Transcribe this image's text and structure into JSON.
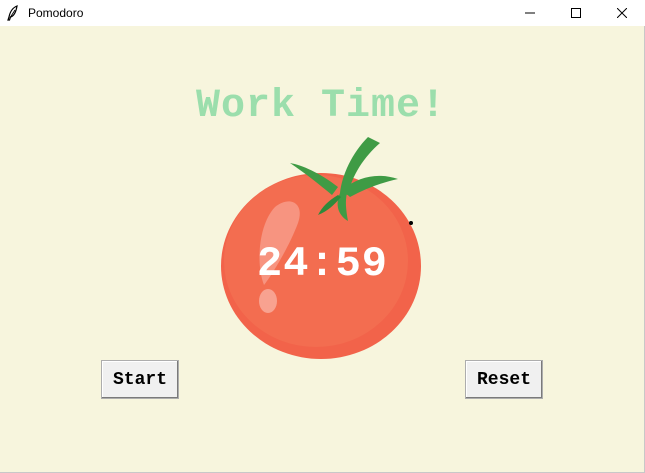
{
  "window": {
    "title": "Pomodoro",
    "controls": {
      "minimize": "–",
      "maximize": "☐",
      "close": "✕"
    }
  },
  "heading": {
    "text": "Work Time!",
    "color": "#9bdeac"
  },
  "timer": {
    "text": "24:59",
    "color": "#ffffff"
  },
  "buttons": {
    "start_label": "Start",
    "reset_label": "Reset"
  },
  "colors": {
    "background": "#f7f5dd",
    "tomato": "#f2634a",
    "leaves": "#3f9b45"
  },
  "icons": {
    "app": "feather-icon",
    "tomato": "tomato-icon"
  }
}
